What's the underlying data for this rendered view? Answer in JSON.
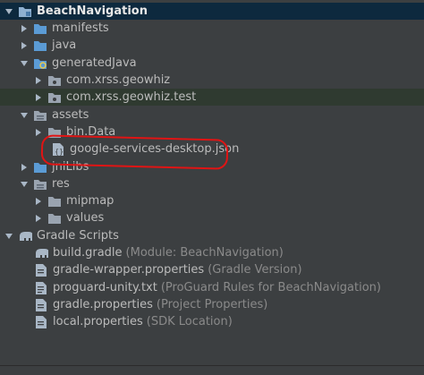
{
  "tree": {
    "root": {
      "label": "BeachNavigation"
    },
    "manifests": {
      "label": "manifests"
    },
    "java": {
      "label": "java"
    },
    "generatedJava": {
      "label": "generatedJava"
    },
    "pkg1": {
      "label": "com.xrss.geowhiz"
    },
    "pkg2": {
      "label": "com.xrss.geowhiz.test"
    },
    "assets": {
      "label": "assets"
    },
    "bindata": {
      "label": "bin.Data"
    },
    "google": {
      "label": "google-services-desktop.json"
    },
    "jnilibs": {
      "label": "jniLibs"
    },
    "res": {
      "label": "res"
    },
    "mipmap": {
      "label": "mipmap"
    },
    "values": {
      "label": "values"
    },
    "gradle": {
      "label": "Gradle Scripts"
    },
    "build": {
      "label": "build.gradle",
      "hint": "(Module: BeachNavigation)"
    },
    "wrapper": {
      "label": "gradle-wrapper.properties",
      "hint": "(Gradle Version)"
    },
    "proguard": {
      "label": "proguard-unity.txt",
      "hint": "(ProGuard Rules for BeachNavigation)"
    },
    "gprops": {
      "label": "gradle.properties",
      "hint": "(Project Properties)"
    },
    "local": {
      "label": "local.properties",
      "hint": "(SDK Location)"
    }
  },
  "colors": {
    "background": "#3c3f41",
    "selection": "#0d293e",
    "highlight_row": "#2f3a30",
    "folder_blue": "#5b9bd5",
    "folder_gray": "#9aa4b0",
    "annotation_red": "#e01414"
  }
}
